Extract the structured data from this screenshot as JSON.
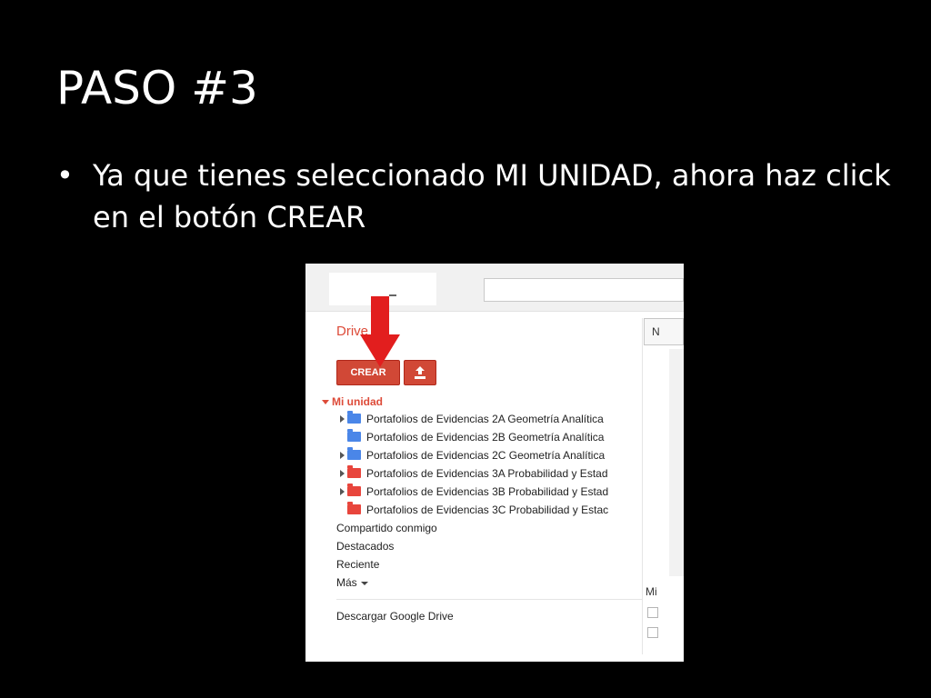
{
  "slide": {
    "title": "PASO #3",
    "bullet": "Ya que tienes  seleccionado MI UNIDAD, ahora haz click en el botón CREAR"
  },
  "drive": {
    "app_label": "Drive",
    "create_label": "CREAR",
    "right_btn_label": "N",
    "right_text": "Mi",
    "my_drive_label": "Mi unidad",
    "folders": [
      {
        "name": "Portafolios de Evidencias 2A Geometría Analítica",
        "color": "#4a86e8",
        "expandable": true
      },
      {
        "name": "Portafolios de Evidencias 2B Geometría Analítica",
        "color": "#4a86e8",
        "expandable": false
      },
      {
        "name": "Portafolios de Evidencias 2C Geometría Analítica",
        "color": "#4a86e8",
        "expandable": true
      },
      {
        "name": "Portafolios de Evidencias 3A Probabilidad y Estad",
        "color": "#e8453c",
        "expandable": true
      },
      {
        "name": "Portafolios de Evidencias 3B Probabilidad y Estad",
        "color": "#e8453c",
        "expandable": true
      },
      {
        "name": "Portafolios de Evidencias 3C Probabilidad y Estac",
        "color": "#e8453c",
        "expandable": false
      }
    ],
    "nav": {
      "shared": "Compartido conmigo",
      "starred": "Destacados",
      "recent": "Reciente",
      "more": "Más",
      "download": "Descargar Google Drive"
    }
  },
  "colors": {
    "accent": "#d14836",
    "label_red": "#dd4b39",
    "arrow": "#e21e1e"
  }
}
